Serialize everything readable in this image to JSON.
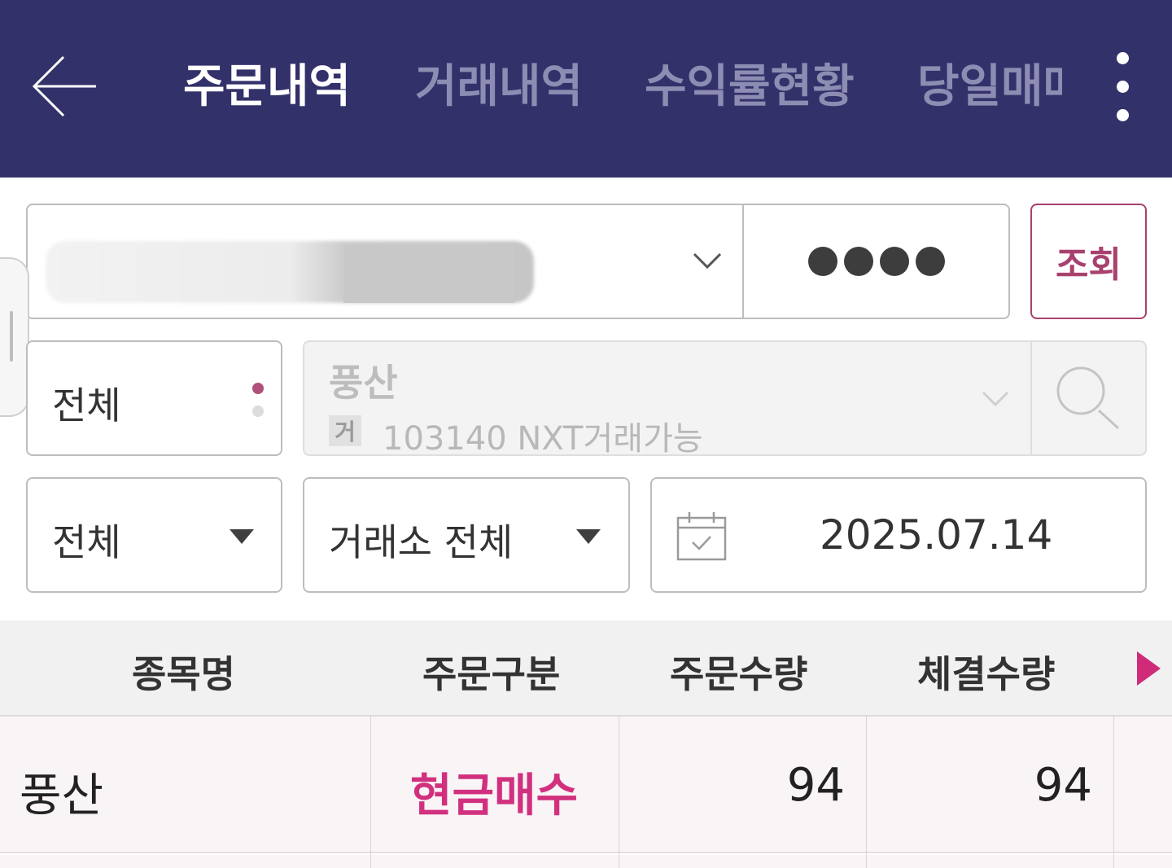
{
  "header": {
    "tabs": [
      {
        "label": "주문내역",
        "active": true
      },
      {
        "label": "거래내역",
        "active": false
      },
      {
        "label": "수익률현황",
        "active": false
      },
      {
        "label": "당일매매",
        "active": false
      }
    ],
    "back_icon": "arrow-left-icon",
    "more_icon": "more-vertical-icon"
  },
  "account": {
    "password_mask": "●●●●",
    "query_label": "조회"
  },
  "filters": {
    "scope": "전체",
    "stock_name": "풍산",
    "stock_badge": "거",
    "stock_code_info": "103140 NXT거래가능",
    "order_type": "전체",
    "exchange": "거래소 전체",
    "date": "2025.07.14"
  },
  "table": {
    "headers": [
      "종목명",
      "주문구분",
      "주문수량",
      "체결수량"
    ],
    "rows": [
      {
        "name": "풍산",
        "order_type": "현금매수",
        "order_qty": "94",
        "filled_qty": "94"
      }
    ]
  },
  "colors": {
    "header_bg": "#33316a",
    "accent": "#a8416f",
    "buy_text": "#d1307f"
  }
}
